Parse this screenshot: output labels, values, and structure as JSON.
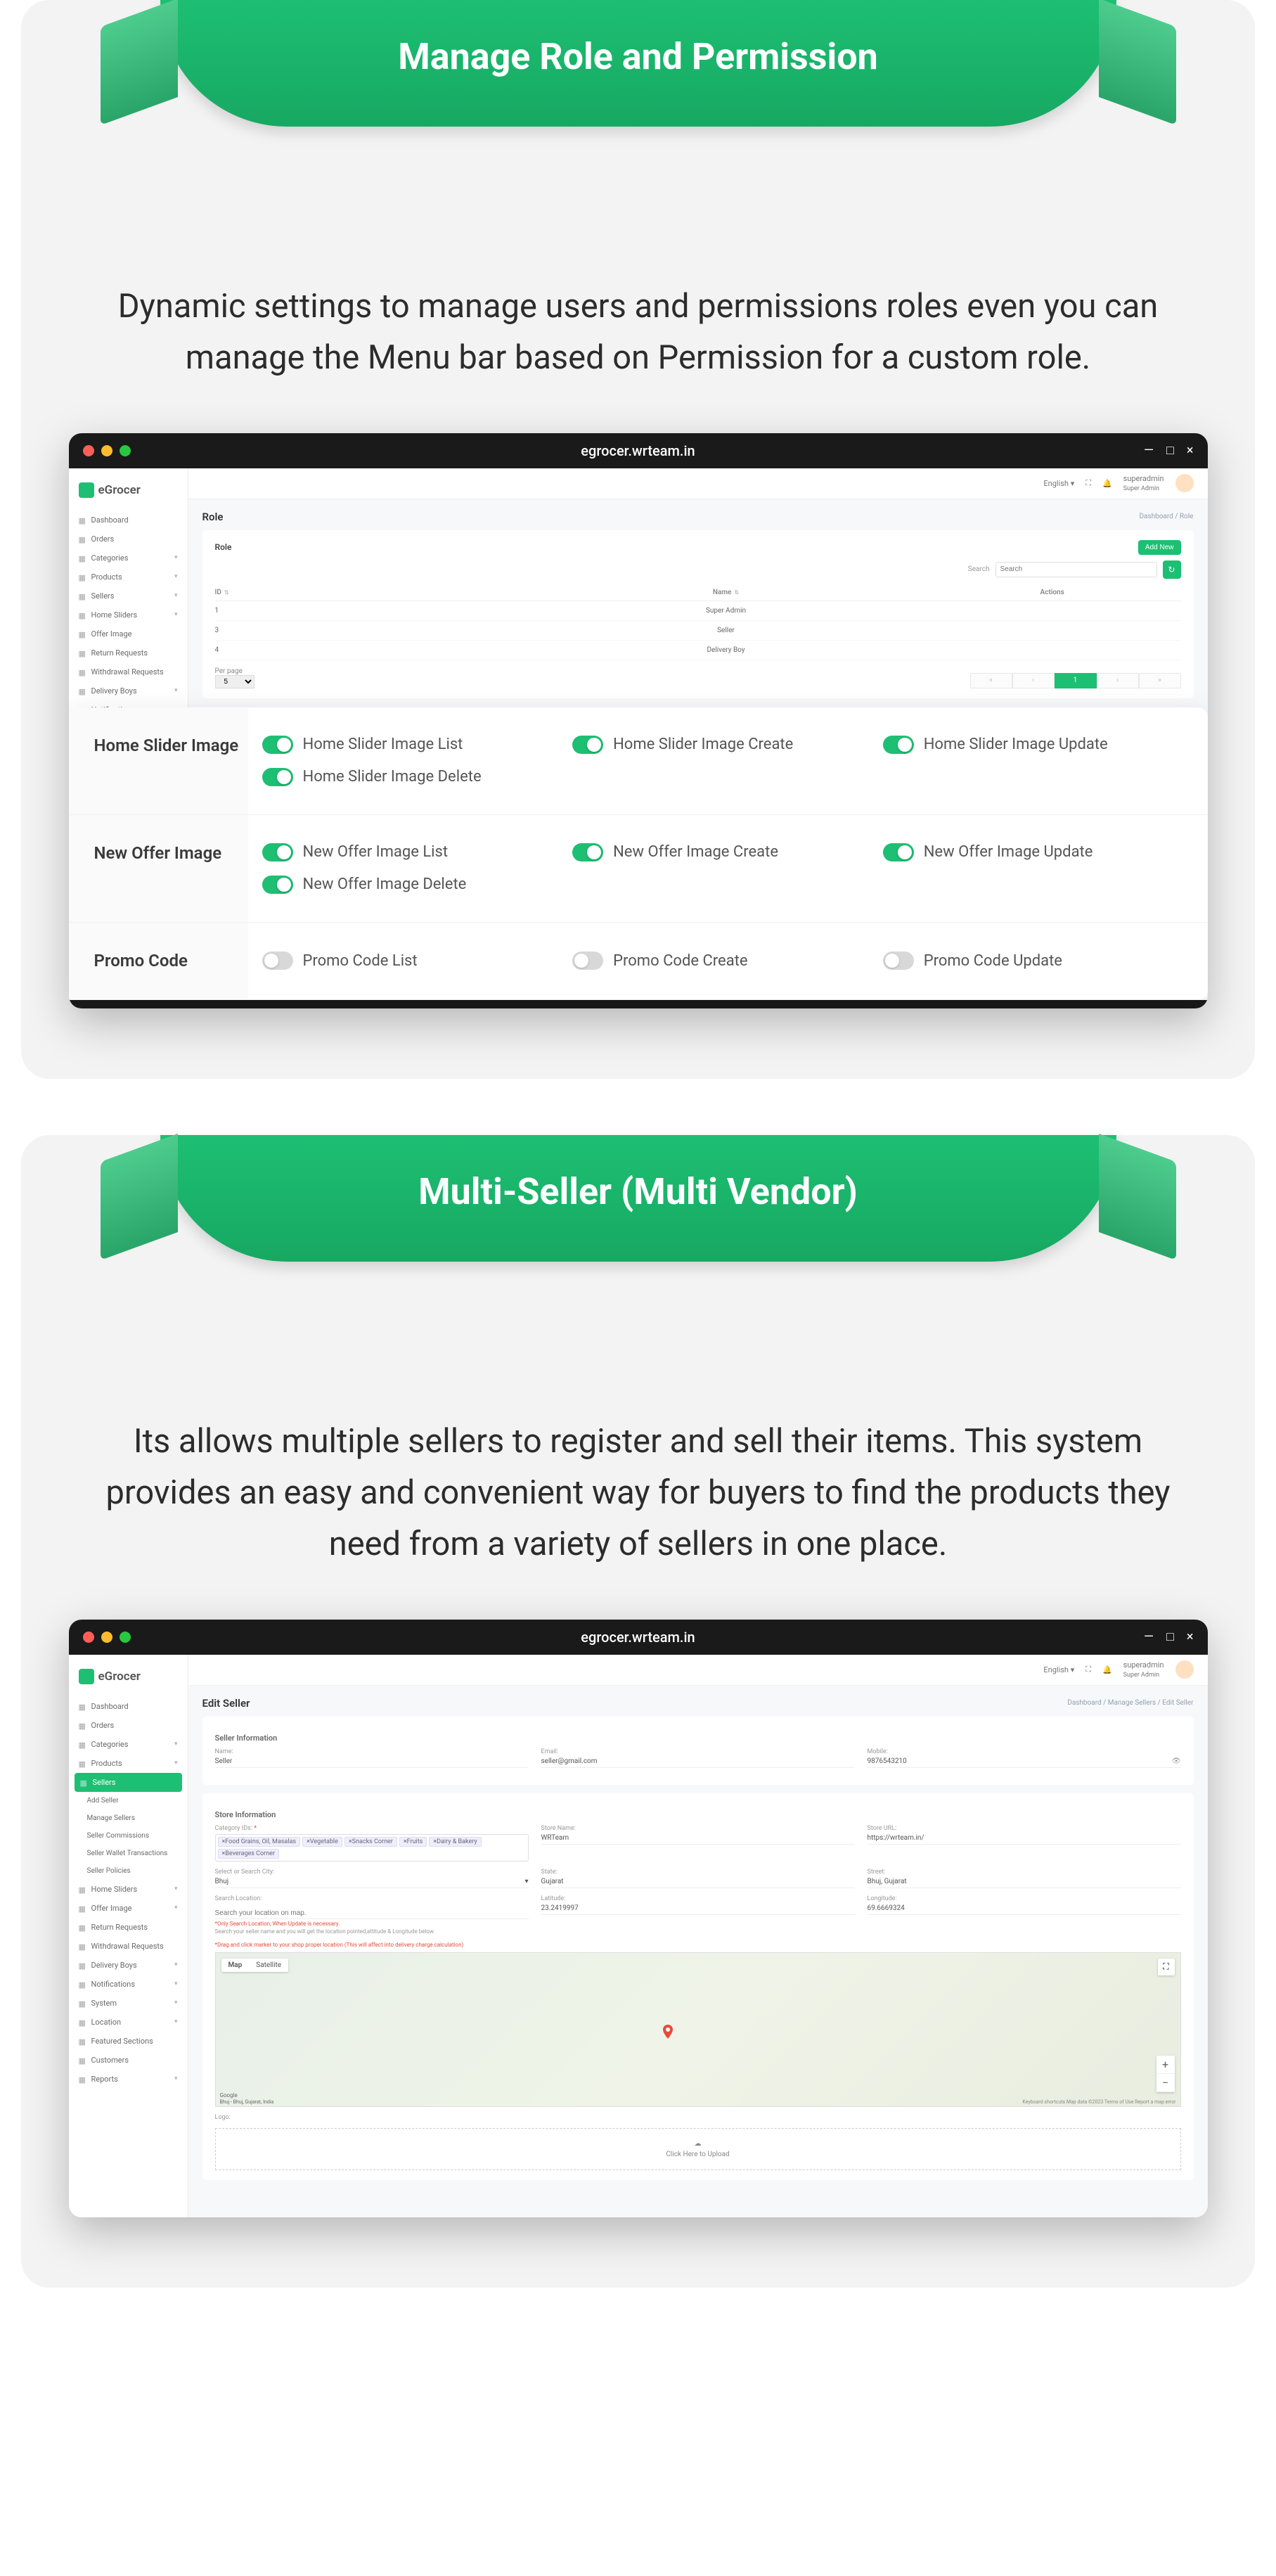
{
  "url": "egrocer.wrteam.in",
  "section1": {
    "banner": "Manage Role and Permission",
    "desc": "Dynamic settings to manage users and permissions roles even you can manage the Menu bar based on Permission for a custom role."
  },
  "section2": {
    "banner": "Multi-Seller (Multi Vendor)",
    "desc": "Its allows multiple sellers to register and sell their items. This system provides an easy and convenient way for buyers to find the products they need from a variety of sellers in one place."
  },
  "app": {
    "brand": "eGrocer",
    "lang": "English",
    "user": {
      "name": "superadmin",
      "role": "Super Admin"
    }
  },
  "nav1": [
    {
      "label": "Dashboard"
    },
    {
      "label": "Orders"
    },
    {
      "label": "Categories",
      "chev": true
    },
    {
      "label": "Products",
      "chev": true
    },
    {
      "label": "Sellers",
      "chev": true
    },
    {
      "label": "Home Sliders",
      "chev": true
    },
    {
      "label": "Offer Image"
    },
    {
      "label": "Return Requests"
    },
    {
      "label": "Withdrawal Requests"
    },
    {
      "label": "Delivery Boys",
      "chev": true
    },
    {
      "label": "Notifications",
      "chev": true
    }
  ],
  "rolePage": {
    "title": "Role",
    "breadcrumb": "Dashboard / Role",
    "cardTitle": "Role",
    "addBtn": "Add New",
    "searchLabel": "Search",
    "searchPlaceholder": "Search",
    "columns": {
      "id": "ID",
      "name": "Name",
      "actions": "Actions"
    },
    "rows": [
      {
        "id": "1",
        "name": "Super Admin"
      },
      {
        "id": "3",
        "name": "Seller"
      },
      {
        "id": "4",
        "name": "Delivery Boy"
      }
    ],
    "perPageLabel": "Per page",
    "perPageValue": "5",
    "pagNums": [
      "«",
      "‹",
      "1",
      "›",
      "»"
    ]
  },
  "permissions": [
    {
      "group": "Home Slider Image",
      "items": [
        {
          "label": "Home Slider Image List",
          "on": true
        },
        {
          "label": "Home Slider Image Create",
          "on": true
        },
        {
          "label": "Home Slider Image Update",
          "on": true
        },
        {
          "label": "Home Slider Image Delete",
          "on": true
        }
      ]
    },
    {
      "group": "New Offer Image",
      "items": [
        {
          "label": "New Offer Image List",
          "on": true
        },
        {
          "label": "New Offer Image Create",
          "on": true
        },
        {
          "label": "New Offer Image Update",
          "on": true
        },
        {
          "label": "New Offer Image Delete",
          "on": true
        }
      ]
    },
    {
      "group": "Promo Code",
      "items": [
        {
          "label": "Promo Code List",
          "on": false
        },
        {
          "label": "Promo Code Create",
          "on": false
        },
        {
          "label": "Promo Code Update",
          "on": false
        }
      ]
    }
  ],
  "nav2": [
    {
      "label": "Dashboard"
    },
    {
      "label": "Orders"
    },
    {
      "label": "Categories",
      "chev": true
    },
    {
      "label": "Products",
      "chev": true
    },
    {
      "label": "Sellers",
      "active": true
    },
    {
      "label": "Add Seller",
      "sub": true
    },
    {
      "label": "Manage Sellers",
      "sub": true
    },
    {
      "label": "Seller Commissions",
      "sub": true
    },
    {
      "label": "Seller Wallet Transactions",
      "sub": true
    },
    {
      "label": "Seller Policies",
      "sub": true
    },
    {
      "label": "Home Sliders",
      "chev": true
    },
    {
      "label": "Offer Image",
      "chev": true
    },
    {
      "label": "Return Requests"
    },
    {
      "label": "Withdrawal Requests"
    },
    {
      "label": "Delivery Boys",
      "chev": true
    },
    {
      "label": "Notifications",
      "chev": true
    },
    {
      "label": "System",
      "chev": true
    },
    {
      "label": "Location",
      "chev": true
    },
    {
      "label": "Featured Sections"
    },
    {
      "label": "Customers"
    },
    {
      "label": "Reports",
      "chev": true
    }
  ],
  "editSeller": {
    "title": "Edit Seller",
    "breadcrumb": "Dashboard / Manage Sellers / Edit Seller",
    "sellerInfoTitle": "Seller Information",
    "storeInfoTitle": "Store Information",
    "fields": {
      "name": {
        "label": "Name:",
        "value": "Seller"
      },
      "email": {
        "label": "Email:",
        "value": "seller@gmail.com"
      },
      "mobile": {
        "label": "Mobile:",
        "value": "9876543210"
      },
      "categoryIds": {
        "label": "Category IDs:"
      },
      "storeName": {
        "label": "Store Name:",
        "value": "WRTeam"
      },
      "storeUrl": {
        "label": "Store URL:",
        "value": "https://wrteam.in/"
      },
      "city": {
        "label": "Select or Search City:",
        "value": "Bhuj"
      },
      "state": {
        "label": "State:",
        "value": "Gujarat"
      },
      "street": {
        "label": "Street:",
        "value": "Bhuj, Gujarat"
      },
      "searchLoc": {
        "label": "Search Location:",
        "placeholder": "Search your location on map."
      },
      "latitude": {
        "label": "Latitude:",
        "value": "23.2419997"
      },
      "longitude": {
        "label": "Longitude:",
        "value": "69.6669324"
      },
      "logo": {
        "label": "Logo:"
      }
    },
    "categoryTags": [
      "×Food Grains, Oil, Masalas",
      "×Vegetable",
      "×Snacks Corner",
      "×Fruits",
      "×Dairy & Bakery",
      "×Beverages Corner"
    ],
    "hintRed1": "*Only Search Location, When Update is necessary.",
    "hintGrey1": "Search your seller name and you will get the location pointed,attitude & Longitude below.",
    "hintRed2": "*Drag and click marker to your shop proper location (This will affect into delivery charge calculation)",
    "mapTabs": [
      "Map",
      "Satellite"
    ],
    "mapAttr": "Google",
    "mapLoc": "Bhuj - Bhuj, Gujarat, India",
    "mapTerms": "Keyboard shortcuts    Map data ©2023    Terms of Use    Report a map error",
    "uploadText": "Click Here to Upload"
  }
}
